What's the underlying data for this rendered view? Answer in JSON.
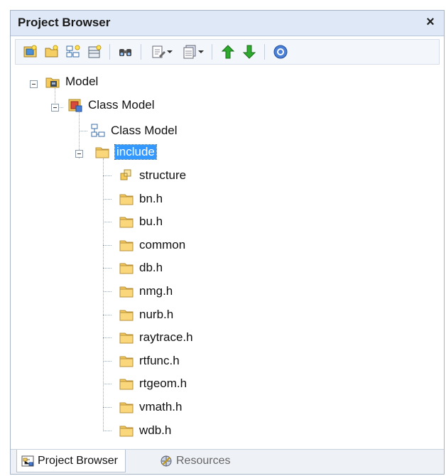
{
  "window": {
    "title": "Project Browser",
    "close_label": "×"
  },
  "toolbar": {
    "buttons": [
      {
        "name": "new-model-icon"
      },
      {
        "name": "new-package-icon"
      },
      {
        "name": "new-diagram-icon"
      },
      {
        "name": "new-element-icon"
      },
      {
        "name": "find-icon"
      },
      {
        "name": "edit-options-icon"
      },
      {
        "name": "view-options-icon"
      },
      {
        "name": "move-up-icon"
      },
      {
        "name": "move-down-icon"
      },
      {
        "name": "help-icon"
      }
    ],
    "accent": "#2eaa2e"
  },
  "tree": {
    "model": "Model",
    "class_model_package": "Class Model",
    "class_model_diagram": "Class Model",
    "include": "include",
    "children": [
      {
        "label": "structure",
        "icon": "class-element-icon"
      },
      {
        "label": "bn.h",
        "icon": "folder-icon"
      },
      {
        "label": "bu.h",
        "icon": "folder-icon"
      },
      {
        "label": "common",
        "icon": "folder-icon"
      },
      {
        "label": "db.h",
        "icon": "folder-icon"
      },
      {
        "label": "nmg.h",
        "icon": "folder-icon"
      },
      {
        "label": "nurb.h",
        "icon": "folder-icon"
      },
      {
        "label": "raytrace.h",
        "icon": "folder-icon"
      },
      {
        "label": "rtfunc.h",
        "icon": "folder-icon"
      },
      {
        "label": "rtgeom.h",
        "icon": "folder-icon"
      },
      {
        "label": "vmath.h",
        "icon": "folder-icon"
      },
      {
        "label": "wdb.h",
        "icon": "folder-icon"
      }
    ]
  },
  "tabs": {
    "project_browser": "Project Browser",
    "resources": "Resources"
  },
  "colors": {
    "selection": "#3399ff",
    "folder": "#f6c95b"
  }
}
